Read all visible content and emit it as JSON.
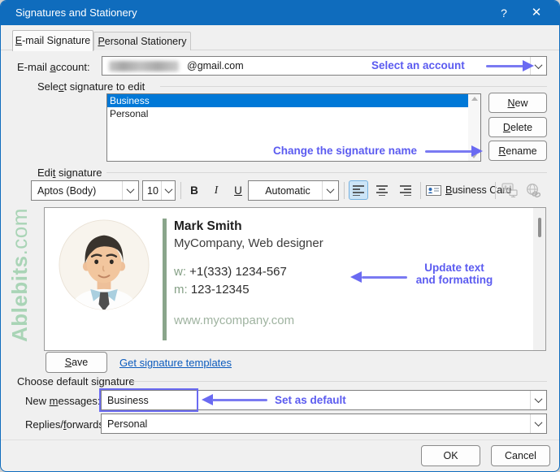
{
  "titlebar": {
    "title": "Signatures and Stationery",
    "help": "?",
    "close": "✕"
  },
  "tabs": {
    "email": {
      "accel": "E",
      "post": "-mail Signature"
    },
    "stationery": {
      "accel": "P",
      "post": "ersonal Stationery"
    }
  },
  "account": {
    "label": {
      "pre": "E-mail ",
      "accel": "a",
      "post": "ccount:"
    },
    "domain": "@gmail.com"
  },
  "select_signature": {
    "label": {
      "pre": "Sele",
      "accel": "c",
      "post": "t signature to edit"
    },
    "items": [
      "Business",
      "Personal"
    ]
  },
  "buttons": {
    "new": {
      "accel": "N",
      "post": "ew"
    },
    "delete": {
      "accel": "D",
      "post": "elete"
    },
    "rename": {
      "accel": "R",
      "post": "ename"
    },
    "save": {
      "accel": "S",
      "post": "ave"
    },
    "ok": "OK",
    "cancel": "Cancel"
  },
  "annotations": {
    "select_account": "Select an account",
    "change_name": "Change the signature name",
    "update_line1": "Update text",
    "update_line2": "and formatting",
    "set_default": "Set as default",
    "color": "#5b5bf0"
  },
  "editor": {
    "label": {
      "pre": "Edi",
      "accel": "t",
      "post": " signature"
    },
    "font_name": "Aptos (Body)",
    "font_size": "10",
    "bold": "B",
    "italic": "I",
    "underline": "U",
    "font_color": "Automatic",
    "business_card": {
      "accel": "B",
      "post": "usiness Card"
    }
  },
  "signature": {
    "name": "Mark Smith",
    "company": "MyCompany, Web designer",
    "work_label": "w:",
    "work_value": "+1(333) 1234-567",
    "mobile_label": "m:",
    "mobile_value": "123-12345",
    "website": "www.mycompany.com"
  },
  "watermark": {
    "bold": "Ablebits",
    "rest": ".com"
  },
  "templates_link": "Get signature templates",
  "defaults": {
    "group_label": "Choose default signature",
    "new_messages_label": {
      "pre": "New ",
      "accel": "m",
      "post": "essages:"
    },
    "new_messages_value": "Business",
    "replies_label": {
      "pre": "Replies/",
      "accel": "f",
      "post": "orwards:"
    },
    "replies_value": "Personal"
  },
  "colors": {
    "titlebar": "#0f6cbd",
    "selection": "#0078d7",
    "annotation": "#5b5bf0",
    "watermark": "#a9d4b6",
    "link": "#0b5bbd",
    "signature_accent": "#8aa58b"
  }
}
